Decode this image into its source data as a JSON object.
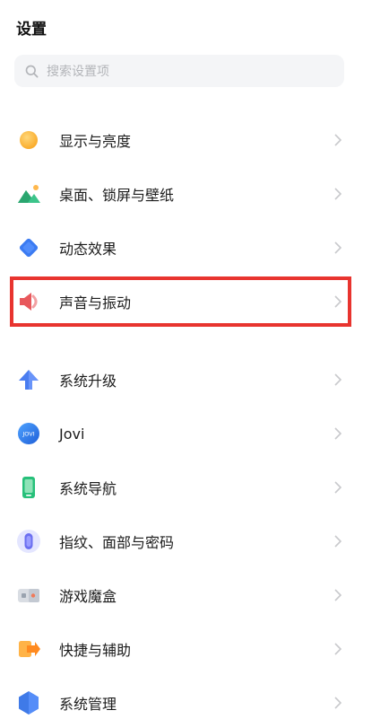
{
  "header": {
    "title": "设置"
  },
  "search": {
    "placeholder": "搜索设置项"
  },
  "settings": {
    "items": [
      {
        "label": "显示与亮度",
        "icon": "sun-icon"
      },
      {
        "label": "桌面、锁屏与壁纸",
        "icon": "wallpaper-mountain-icon"
      },
      {
        "label": "动态效果",
        "icon": "diamond-icon"
      },
      {
        "label": "声音与振动",
        "icon": "speaker-icon"
      },
      {
        "label": "系统升级",
        "icon": "upgrade-arrow-icon"
      },
      {
        "label": "Jovi",
        "icon": "jovi-icon"
      },
      {
        "label": "系统导航",
        "icon": "phone-navigation-icon"
      },
      {
        "label": "指纹、面部与密码",
        "icon": "fingerprint-icon"
      },
      {
        "label": "游戏魔盒",
        "icon": "game-box-icon"
      },
      {
        "label": "快捷与辅助",
        "icon": "shortcut-icon"
      },
      {
        "label": "系统管理",
        "icon": "system-hexagon-icon"
      }
    ]
  },
  "jovi_badge": "JOVI",
  "colors": {
    "highlight": "#e8342f",
    "search_bg": "#f4f5f7",
    "chevron": "#c8c9cc"
  }
}
